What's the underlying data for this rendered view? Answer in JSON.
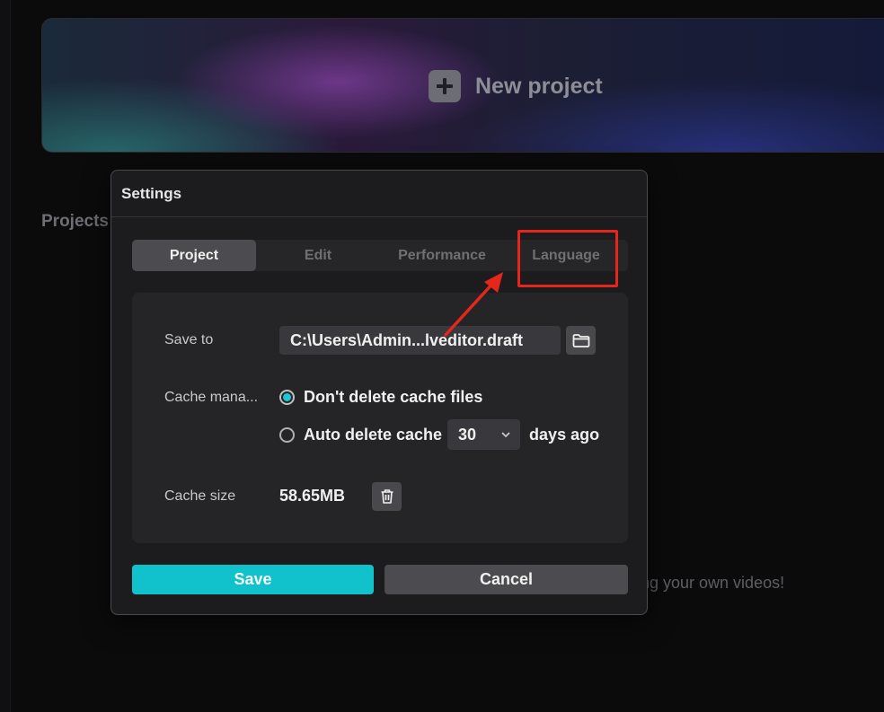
{
  "background": {
    "new_project_label": "New project",
    "projects_heading": "Projects",
    "hint_text": "ng your own videos!"
  },
  "dialog": {
    "title": "Settings",
    "tabs": [
      {
        "label": "Project",
        "active": true
      },
      {
        "label": "Edit",
        "active": false
      },
      {
        "label": "Performance",
        "active": false
      },
      {
        "label": "Language",
        "active": false
      }
    ],
    "highlighted_tab": "Language",
    "save_to": {
      "label": "Save to",
      "value": "C:\\Users\\Admin...lveditor.draft",
      "button_icon": "folder-icon"
    },
    "cache_management": {
      "label": "Cache mana...",
      "options": [
        {
          "label": "Don't delete cache files",
          "selected": true
        },
        {
          "label": "Auto delete cache",
          "selected": false
        }
      ],
      "days_value": "30",
      "days_suffix": "days ago"
    },
    "cache_size": {
      "label": "Cache size",
      "value": "58.65MB",
      "button_icon": "trash-icon"
    },
    "buttons": {
      "save": "Save",
      "cancel": "Cancel"
    }
  },
  "colors": {
    "accent": "#11c1cb",
    "annotation": "#e5271b",
    "dialog_bg": "#1c1c1e"
  }
}
